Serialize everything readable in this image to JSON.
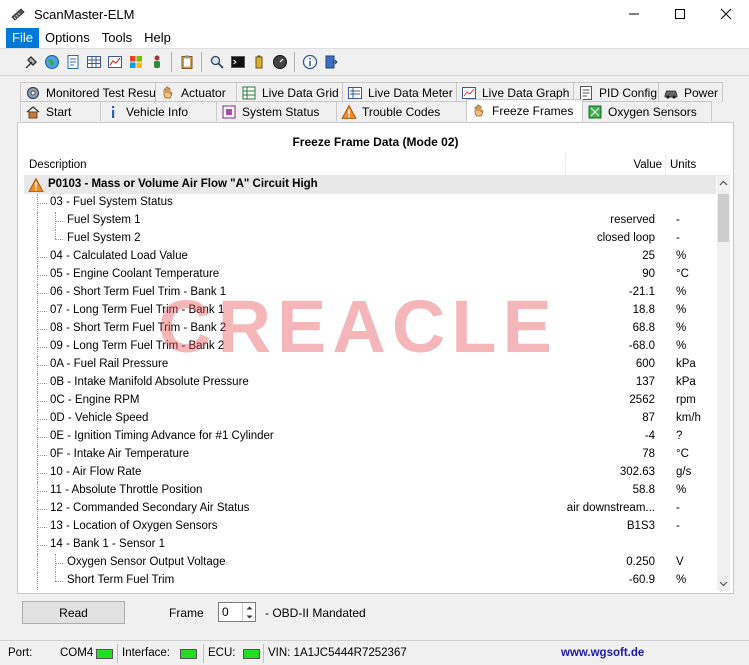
{
  "window": {
    "title": "ScanMaster-ELM",
    "icon": "scanner-icon",
    "controls": [
      "minimize-icon",
      "maximize-icon",
      "close-icon"
    ]
  },
  "menu": {
    "items": [
      {
        "label": "File"
      },
      {
        "label": "Options"
      },
      {
        "label": "Tools"
      },
      {
        "label": "Help"
      }
    ]
  },
  "toolbar": {
    "icons": [
      "connect-icon",
      "globe-icon",
      "report-icon",
      "table-icon",
      "chart-icon",
      "windows-icon",
      "person-icon",
      "clipboard-icon",
      "search-icon",
      "terminal-icon",
      "battery-icon",
      "gauge-icon",
      "info-icon",
      "exit-icon"
    ]
  },
  "tabs": {
    "row1": [
      {
        "label": "Monitored Test Results",
        "icon": "gear-icon"
      },
      {
        "label": "Actuator",
        "icon": "hand-icon"
      },
      {
        "label": "Live Data Grid",
        "icon": "grid-icon"
      },
      {
        "label": "Live Data Meter",
        "icon": "meter-icon"
      },
      {
        "label": "Live Data Graph",
        "icon": "graph-icon"
      },
      {
        "label": "PID Config",
        "icon": "config-icon"
      },
      {
        "label": "Power",
        "icon": "car-icon"
      }
    ],
    "row2": [
      {
        "label": "Start",
        "icon": "home-icon"
      },
      {
        "label": "Vehicle Info",
        "icon": "info-icon"
      },
      {
        "label": "System Status",
        "icon": "status-icon"
      },
      {
        "label": "Trouble Codes",
        "icon": "warning-icon"
      },
      {
        "label": "Freeze Frames",
        "icon": "hand-icon",
        "selected": true
      },
      {
        "label": "Oxygen Sensors",
        "icon": "sensor-icon"
      }
    ]
  },
  "freeze": {
    "title": "Freeze Frame Data (Mode 02)",
    "columns": {
      "description": "Description",
      "value": "Value",
      "units": "Units"
    },
    "rows": [
      {
        "level": 0,
        "desc": "P0103 - Mass or Volume Air Flow \"A\" Circuit High",
        "value": "",
        "units": "",
        "icon": "warning-icon"
      },
      {
        "level": 1,
        "desc": "03 - Fuel System Status",
        "value": "",
        "units": ""
      },
      {
        "level": 2,
        "desc": "Fuel System 1",
        "value": "reserved",
        "units": "-"
      },
      {
        "level": 2,
        "desc": "Fuel System 2",
        "value": "closed loop",
        "units": "-"
      },
      {
        "level": 1,
        "desc": "04 - Calculated Load Value",
        "value": "25",
        "units": "%"
      },
      {
        "level": 1,
        "desc": "05 - Engine Coolant Temperature",
        "value": "90",
        "units": "°C"
      },
      {
        "level": 1,
        "desc": "06 - Short Term Fuel Trim - Bank 1",
        "value": "-21.1",
        "units": "%"
      },
      {
        "level": 1,
        "desc": "07 - Long Term Fuel Trim - Bank 1",
        "value": "18.8",
        "units": "%"
      },
      {
        "level": 1,
        "desc": "08 - Short Term Fuel Trim - Bank 2",
        "value": "68.8",
        "units": "%"
      },
      {
        "level": 1,
        "desc": "09 - Long Term Fuel Trim - Bank 2",
        "value": "-68.0",
        "units": "%"
      },
      {
        "level": 1,
        "desc": "0A - Fuel Rail Pressure",
        "value": "600",
        "units": "kPa"
      },
      {
        "level": 1,
        "desc": "0B - Intake Manifold Absolute Pressure",
        "value": "137",
        "units": "kPa"
      },
      {
        "level": 1,
        "desc": "0C - Engine RPM",
        "value": "2562",
        "units": "rpm"
      },
      {
        "level": 1,
        "desc": "0D - Vehicle Speed",
        "value": "87",
        "units": "km/h"
      },
      {
        "level": 1,
        "desc": "0E - Ignition Timing Advance for #1 Cylinder",
        "value": "-4",
        "units": "?"
      },
      {
        "level": 1,
        "desc": "0F - Intake Air Temperature",
        "value": "78",
        "units": "°C"
      },
      {
        "level": 1,
        "desc": "10 - Air Flow Rate",
        "value": "302.63",
        "units": "g/s"
      },
      {
        "level": 1,
        "desc": "11 - Absolute Throttle Position",
        "value": "58.8",
        "units": "%"
      },
      {
        "level": 1,
        "desc": "12 - Commanded Secondary Air Status",
        "value": "air downstream...",
        "units": "-"
      },
      {
        "level": 1,
        "desc": "13 - Location of Oxygen Sensors",
        "value": "B1S3",
        "units": "-"
      },
      {
        "level": 1,
        "desc": "14 - Bank 1 - Sensor 1",
        "value": "",
        "units": ""
      },
      {
        "level": 2,
        "desc": "Oxygen Sensor Output Voltage",
        "value": "0.250",
        "units": "V"
      },
      {
        "level": 2,
        "desc": "Short Term Fuel Trim",
        "value": "-60.9",
        "units": "%"
      }
    ]
  },
  "watermark": "CREACLE",
  "controls": {
    "read_label": "Read",
    "frame_label": "Frame",
    "frame_value": "0",
    "frame_desc": "- OBD-II Mandated"
  },
  "status": {
    "port_label": "Port:",
    "port_value": "COM4",
    "interface_label": "Interface:",
    "ecu_label": "ECU:",
    "vin": "VIN: 1A1JC5444R7252367",
    "website": "www.wgsoft.de",
    "led_color": "#22dd22"
  }
}
